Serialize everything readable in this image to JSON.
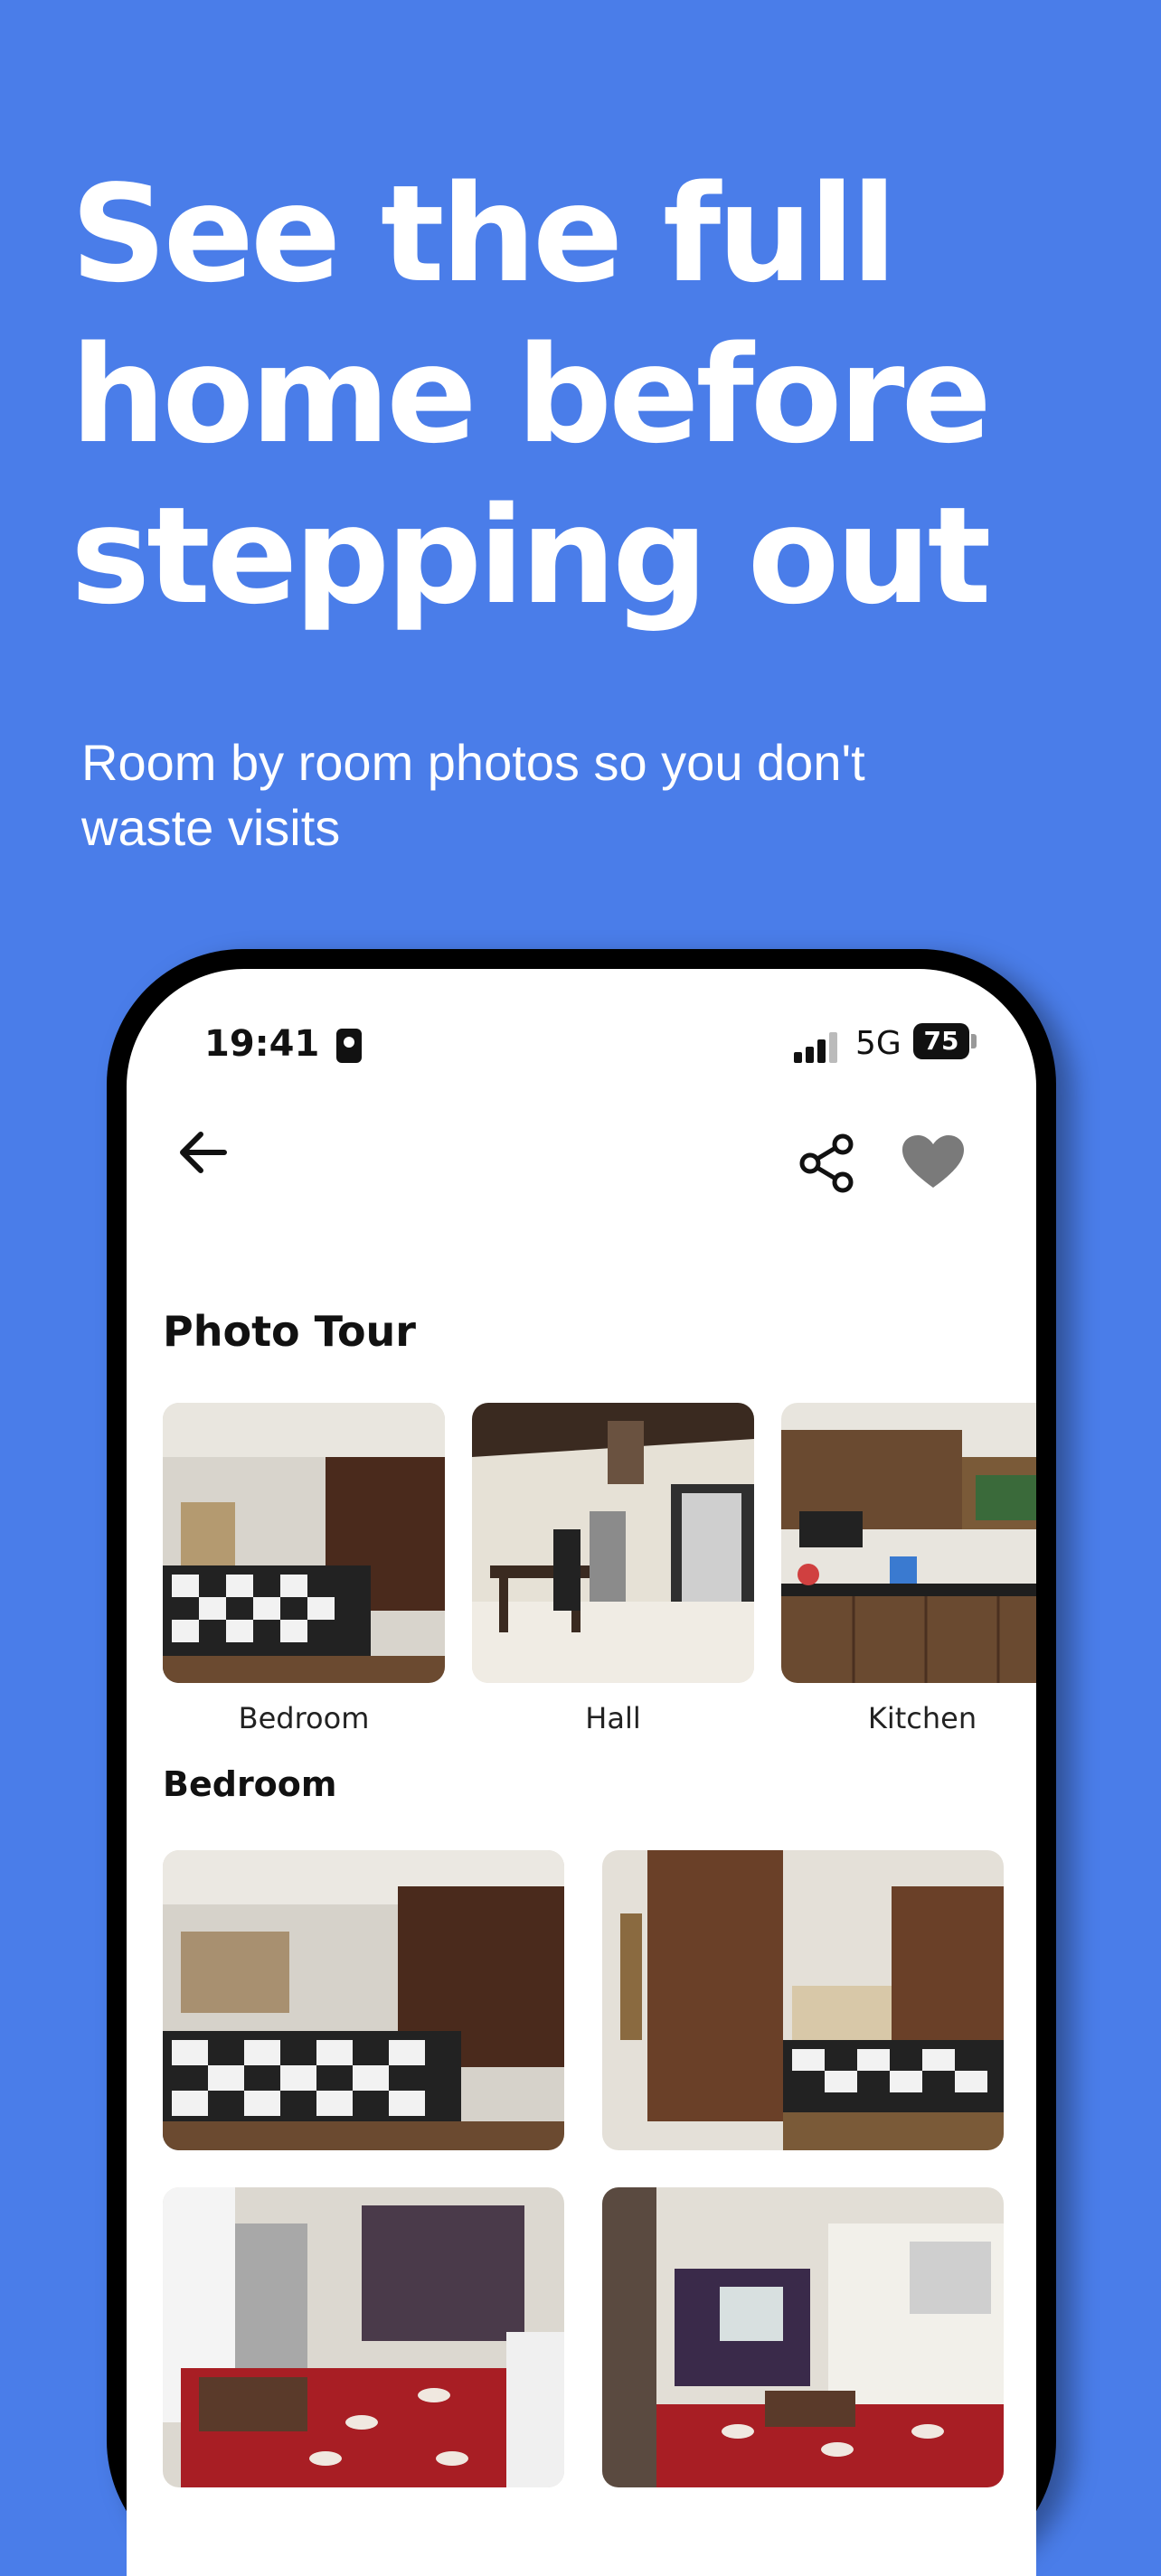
{
  "hero": {
    "headline_lines": [
      "See the full",
      "home before",
      "stepping out"
    ],
    "subhead": "Room by room photos so you don't waste visits"
  },
  "status_bar": {
    "time": "19:41",
    "network": "5G",
    "battery": "75",
    "icons": [
      "id-card-icon",
      "signal-icon",
      "battery-icon"
    ]
  },
  "toolbar": {
    "icons": [
      "back-arrow-icon",
      "share-icon",
      "heart-icon"
    ],
    "heart_color": "#7A7A7A"
  },
  "photo_tour": {
    "title": "Photo Tour",
    "rooms": [
      {
        "label": "Bedroom"
      },
      {
        "label": "Hall"
      },
      {
        "label": "Kitchen"
      }
    ]
  },
  "bedroom_section": {
    "title": "Bedroom",
    "photo_count_visible": 4
  },
  "colors": {
    "background": "#4A7DE9",
    "text_on_background": "#FFFFFF",
    "phone_frame": "#000000"
  }
}
